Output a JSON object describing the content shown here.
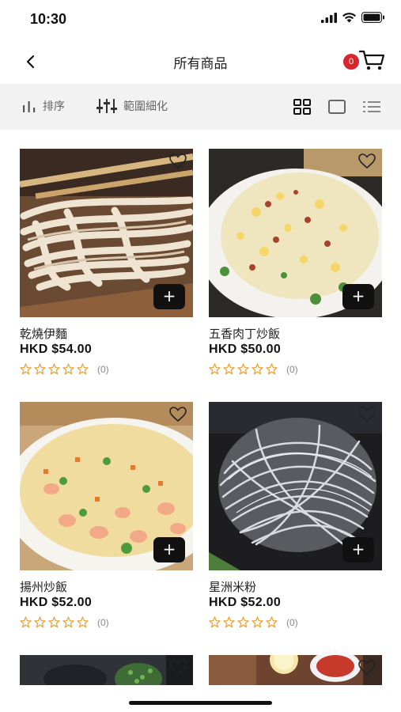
{
  "status_bar": {
    "time": "10:30",
    "icons": [
      "signal-icon",
      "wifi-icon",
      "battery-icon"
    ]
  },
  "header": {
    "title": "所有商品",
    "cart_count": "0",
    "accent": "#d8262e"
  },
  "toolbar": {
    "sort_label": "排序",
    "filter_label": "範圍細化",
    "view_modes": [
      "grid-view-icon",
      "single-view-icon",
      "list-view-icon"
    ]
  },
  "products": [
    {
      "name": "乾燒伊麵",
      "price": "HKD $54.00",
      "rating_count": "(0)",
      "image": "noodles-image"
    },
    {
      "name": "五香肉丁炒飯",
      "price": "HKD $50.00",
      "rating_count": "(0)",
      "image": "fried-rice-pork-image"
    },
    {
      "name": "揚州炒飯",
      "price": "HKD $52.00",
      "rating_count": "(0)",
      "image": "yangzhou-rice-image"
    },
    {
      "name": "星洲米粉",
      "price": "HKD $52.00",
      "rating_count": "(0)",
      "image": "vermicelli-image"
    },
    {
      "name": "",
      "price": "",
      "rating_count": "",
      "image": "dish-image"
    },
    {
      "name": "",
      "price": "",
      "rating_count": "",
      "image": "dish-image"
    }
  ],
  "colors": {
    "star": "#e8a33d",
    "toolbar_bg": "#f2f2f2",
    "add_button": "#111111"
  }
}
